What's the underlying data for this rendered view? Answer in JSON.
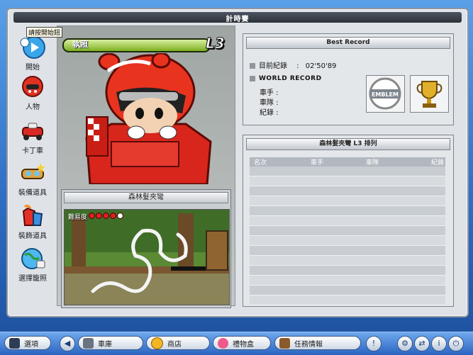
{
  "window": {
    "title": "計時賽"
  },
  "tooltip": "請按開始鈕",
  "sidebar": {
    "items": [
      {
        "label": "開始",
        "icon": "play-icon"
      },
      {
        "label": "人物",
        "icon": "character-icon"
      },
      {
        "label": "卡丁車",
        "icon": "kart-icon"
      },
      {
        "label": "裝備道具",
        "icon": "goggles-icon"
      },
      {
        "label": "裝飾道具",
        "icon": "clothing-icon"
      },
      {
        "label": "選擇籠照",
        "icon": "globe-icon"
      }
    ]
  },
  "license": {
    "label": "執照",
    "level": "L3"
  },
  "track": {
    "name": "森林髮夾彎",
    "difficulty_label": "難易度",
    "difficulty_level": 4,
    "difficulty_max": 5
  },
  "best_record": {
    "title": "Best Record",
    "current_label": "目前紀錄",
    "separator": ":",
    "current_value": "02'50'89",
    "world_label": "WORLD RECORD",
    "driver_label": "車手 :",
    "team_label": "車隊 :",
    "record_label": "紀錄 :",
    "emblem_text": "EMBLEM"
  },
  "ranking": {
    "title": "森林髮夾彎 L3 排列",
    "columns": [
      "名次",
      "車手",
      "車隊",
      "紀錄"
    ],
    "rows": 14
  },
  "taskbar": {
    "options_label": "選項",
    "garage_label": "車庫",
    "shop_label": "商店",
    "giftbox_label": "禮物盒",
    "mission_label": "任務情報"
  },
  "colors": {
    "accent": "#3b7fd0",
    "license_bar": "#7cb020",
    "difficulty_on": "#e02020",
    "difficulty_off": "#ffffff"
  }
}
